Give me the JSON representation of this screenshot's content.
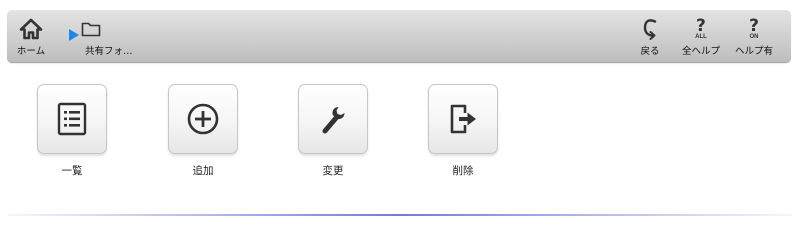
{
  "toolbar": {
    "home": {
      "label": "ホーム",
      "icon": "home-icon"
    },
    "breadcrumb_arrow_icon": "play-arrow-icon",
    "folder": {
      "label": "共有フォ…",
      "icon": "folder-icon"
    },
    "back": {
      "label": "戻る",
      "icon": "back-icon"
    },
    "help_all": {
      "label": "全ヘルプ",
      "glyph": "?",
      "sub": "ALL",
      "icon": "help-all-icon"
    },
    "help_on": {
      "label": "ヘルプ有",
      "glyph": "?",
      "sub": "ON",
      "icon": "help-on-icon"
    }
  },
  "actions": [
    {
      "label": "一覧",
      "icon": "list-icon"
    },
    {
      "label": "追加",
      "icon": "add-circle-icon"
    },
    {
      "label": "変更",
      "icon": "wrench-icon"
    },
    {
      "label": "削除",
      "icon": "exit-arrow-icon"
    }
  ],
  "colors": {
    "accent_arrow": "#1f87e8",
    "toolbar_top": "#e3e3e3",
    "toolbar_bottom": "#bdbdbd",
    "divider": "#4650c8"
  }
}
